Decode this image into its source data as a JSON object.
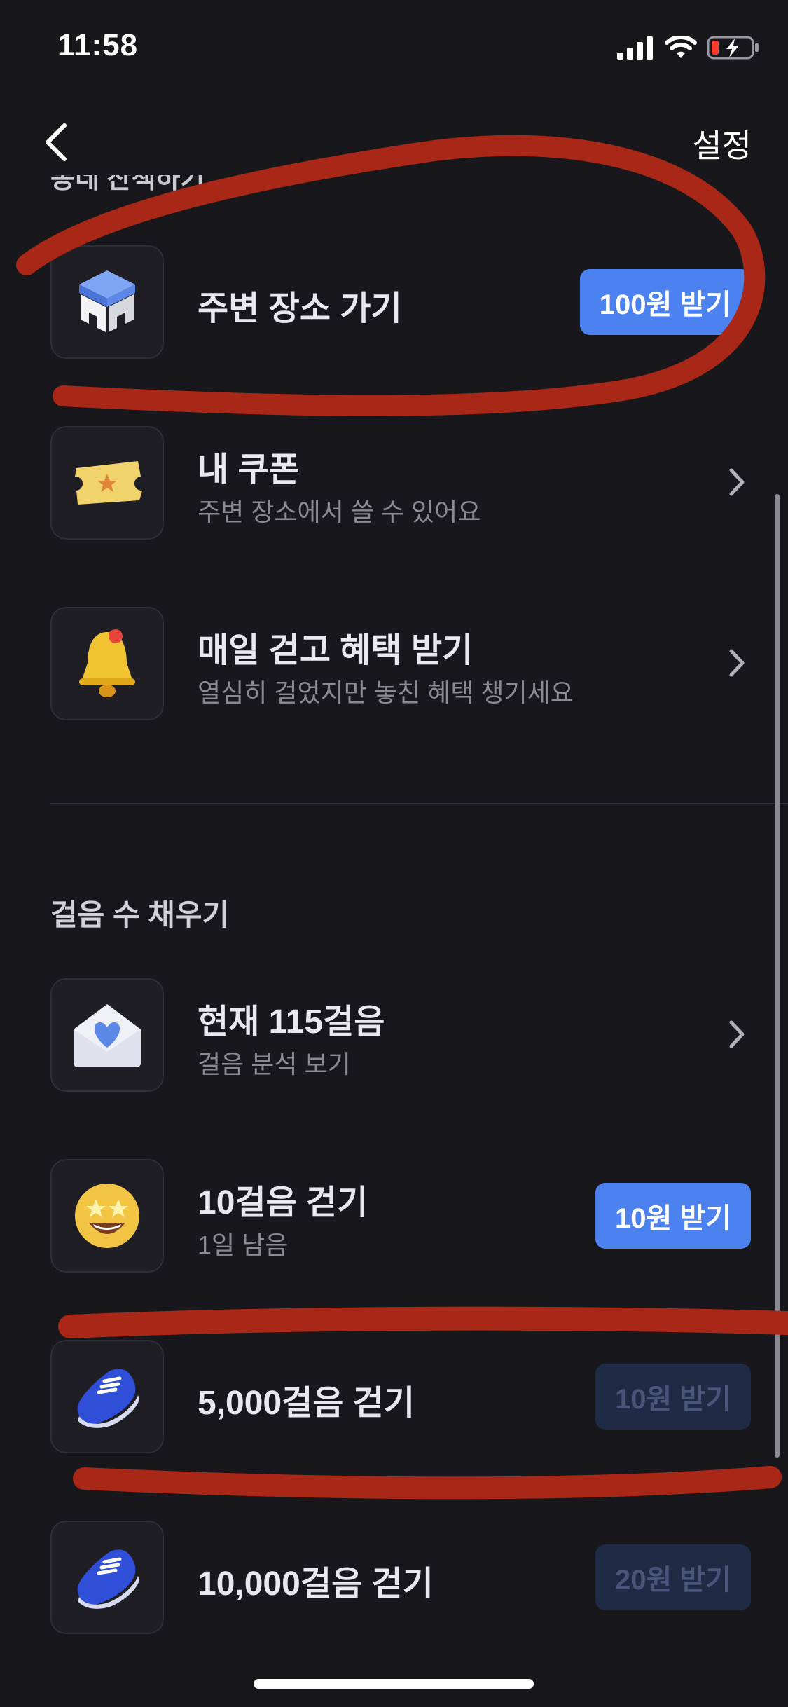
{
  "status_bar": {
    "time": "11:58"
  },
  "nav": {
    "settings_label": "설정"
  },
  "top_section": {
    "partial_header": "동네 산책하기",
    "items": [
      {
        "title": "주변 장소 가기",
        "reward": "100원 받기",
        "icon": "stool-icon"
      },
      {
        "title": "내 쿠폰",
        "subtitle": "주변 장소에서 쓸 수 있어요",
        "icon": "ticket-icon"
      },
      {
        "title": "매일 걷고 혜택 받기",
        "subtitle": "열심히 걸었지만 놓친 혜택 챙기세요",
        "icon": "bell-icon"
      }
    ]
  },
  "steps_section": {
    "title": "걸음 수 채우기",
    "items": [
      {
        "title": "현재 115걸음",
        "subtitle": "걸음 분석 보기",
        "icon": "heart-envelope-icon"
      },
      {
        "title": "10걸음 걷기",
        "subtitle": "1일 남음",
        "reward": "10원 받기",
        "reward_state": "active",
        "icon": "star-eyes-face-icon"
      },
      {
        "title": "5,000걸음 걷기",
        "reward": "10원 받기",
        "reward_state": "disabled",
        "icon": "sneaker-icon"
      },
      {
        "title": "10,000걸음 걷기",
        "reward": "20원 받기",
        "reward_state": "disabled",
        "icon": "sneaker-icon"
      }
    ]
  },
  "colors": {
    "background": "#17171c",
    "accent_blue": "#4b82f0",
    "disabled_button": "#1f2a44",
    "annotation_red": "#b02a1a"
  }
}
